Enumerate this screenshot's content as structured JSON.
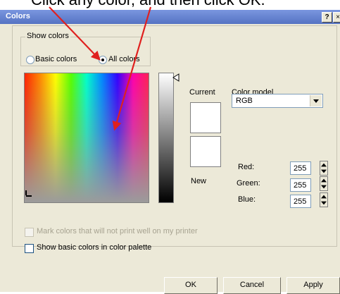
{
  "annotation": {
    "text": "Click any color, and then click OK.",
    "color": "#e0201e"
  },
  "dialog": {
    "title": "Colors",
    "help_glyph": "?",
    "close_glyph": "×"
  },
  "show_colors": {
    "legend": "Show colors",
    "options": [
      "Basic colors",
      "All colors"
    ],
    "selected": "All colors"
  },
  "labels": {
    "current": "Current",
    "new": "New",
    "color_model": "Color model"
  },
  "color_model": {
    "value": "RGB"
  },
  "rgb": {
    "red_label": "Red:",
    "green_label": "Green:",
    "blue_label": "Blue:",
    "red": "255",
    "green": "255",
    "blue": "255"
  },
  "options": {
    "mark_colors": "Mark colors that will not print well on my printer",
    "mark_colors_checked": false,
    "mark_colors_enabled": false,
    "show_basic": "Show basic colors in color palette",
    "show_basic_checked": false
  },
  "buttons": {
    "ok": "OK",
    "cancel": "Cancel",
    "apply": "Apply"
  },
  "colors": {
    "current": "#ffffff",
    "new": "#ffffff",
    "dialog_bg": "#ece9d8",
    "titlebar": "#6a87d4"
  }
}
